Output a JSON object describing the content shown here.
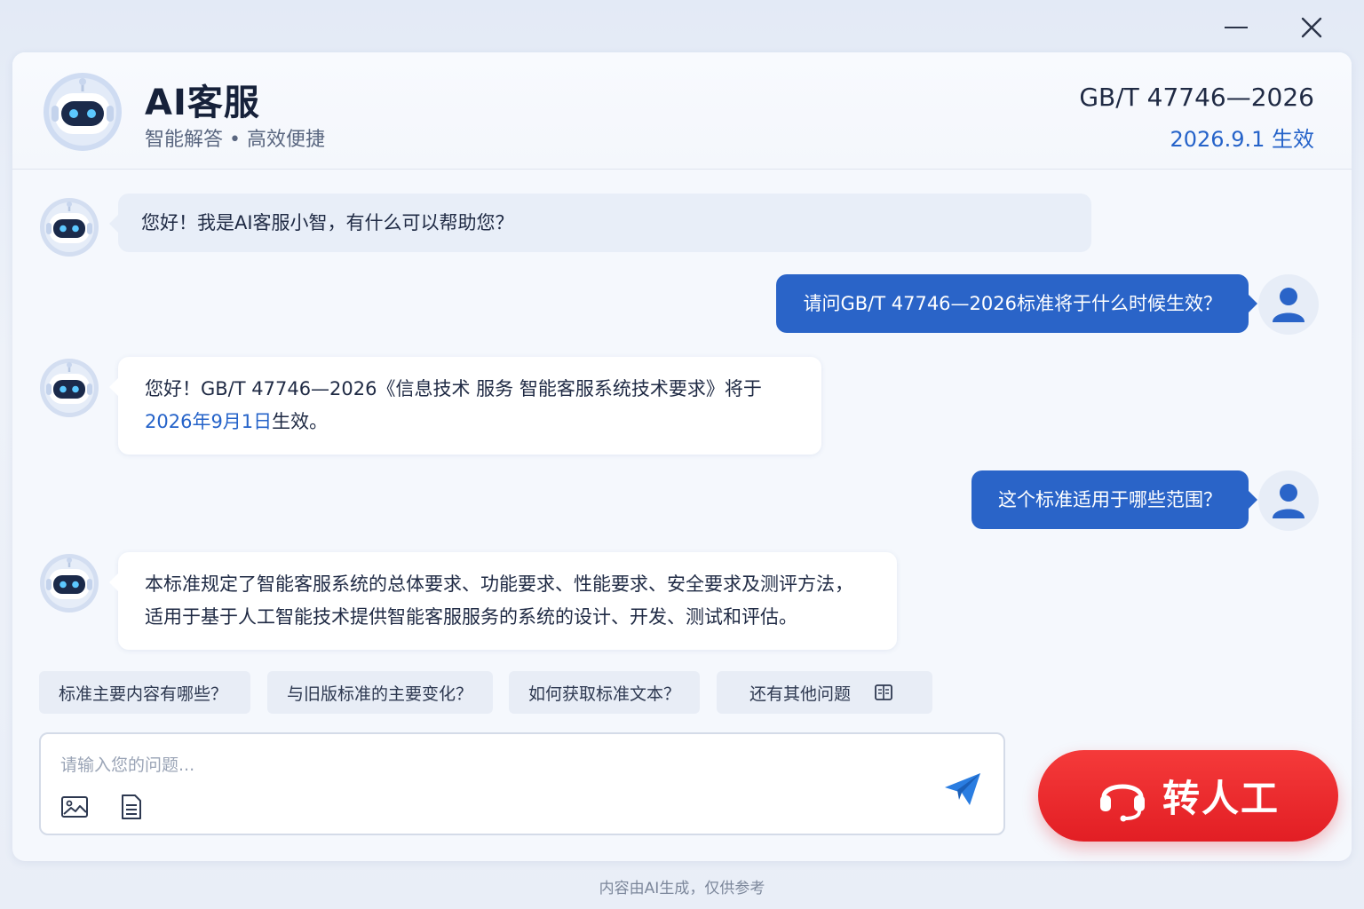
{
  "window": {
    "minimize_icon": "minimize-icon",
    "close_icon": "close-icon"
  },
  "header": {
    "title": "AI客服",
    "subtitle": "智能解答 • 高效便捷",
    "standard_code": "GB/T 47746—2026",
    "effective_date": "2026.9.1 生效"
  },
  "messages": [
    {
      "role": "bot",
      "text": "您好！我是AI客服小智，有什么可以帮助您？"
    },
    {
      "role": "user",
      "text": "请问GB/T 47746—2026标准将于什么时候生效？"
    },
    {
      "role": "bot",
      "text_before": "您好！GB/T 47746—2026《信息技术 服务 智能客服系统技术要求》将于",
      "highlight": "2026年9月1日",
      "text_after": "生效。"
    },
    {
      "role": "user",
      "text": "这个标准适用于哪些范围？"
    },
    {
      "role": "bot",
      "line1": "本标准规定了智能客服系统的总体要求、功能要求、性能要求、安全要求及测评方法，",
      "line2": "适用于基于人工智能技术提供智能客服服务的系统的设计、开发、测试和评估。"
    }
  ],
  "suggestions": [
    "标准主要内容有哪些？",
    "与旧版标准的主要变化？",
    "如何获取标准文本？",
    "还有其他问题"
  ],
  "input": {
    "placeholder": "请输入您的问题...",
    "value": ""
  },
  "human_button": {
    "label": "转人工"
  },
  "footer": {
    "disclaimer": "内容由AI生成，仅供参考"
  },
  "colors": {
    "accent": "#2563c9",
    "user_bubble": "#2a64c8",
    "human_button": "#e8262b"
  }
}
